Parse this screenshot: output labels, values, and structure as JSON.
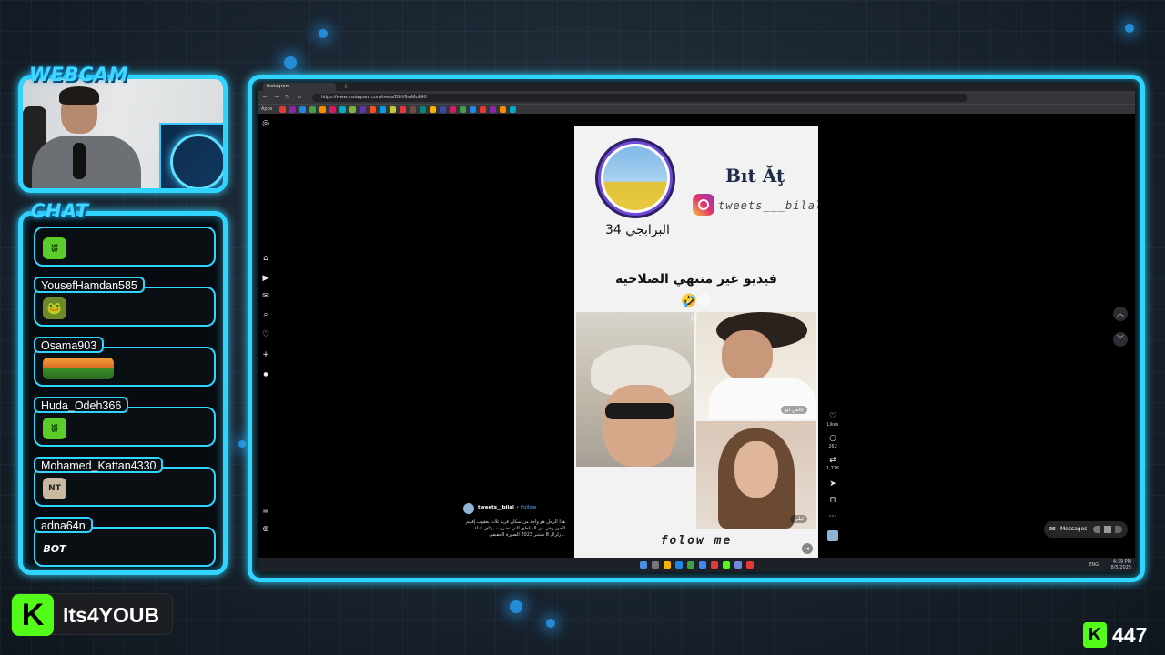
{
  "overlay": {
    "webcam_label": "WEBCAM",
    "chat_label": "CHAT",
    "streamer_name": "Its4YOUB",
    "viewer_count": "447",
    "accent_color": "#2fd4ff",
    "kick_color": "#53fc18"
  },
  "chat": {
    "messages": [
      {
        "username": "",
        "emote": "green-blob-emote"
      },
      {
        "username": "YousefHamdan585",
        "emote": "frog-emote"
      },
      {
        "username": "Osama903",
        "emote": "pixel-strip-emote"
      },
      {
        "username": "Huda_Odeh366",
        "emote": "green-blob-emote"
      },
      {
        "username": "Mohamed_Kattan4330",
        "emote": "NT"
      },
      {
        "username": "adna64n",
        "emote": "BOT"
      }
    ]
  },
  "browser": {
    "tab_title": "Instagram",
    "url": "https://www.instagram.com/reels/DbV6mMo8iK/",
    "bookmarks_label": "Apps"
  },
  "reel": {
    "brand": "Bıt Ăţ",
    "handle": "tweets___bilal",
    "profile_name_ar": "البرابجي 34",
    "caption_ar": "فيديو غير منتهي الصلاحية",
    "caption_emoji": "🤣😂",
    "video_label_top": "خاص ابو",
    "video_label_bottom": "ليلى",
    "follow_text": "folow me",
    "author": "tweets__bilal",
    "follow_link": "• Follow",
    "author_caption": "هذا الرجل هو واحد من سكان قرية ثلاث يعقوب إقليم الحوز وهي من المناطق التي تضررت برئاف أثناء زلزال 8 شتنبر 2023 الصورة الحقيقي..."
  },
  "actions": {
    "likes_label": "Likes",
    "comments_count": "262",
    "reposts_count": "1,776"
  },
  "messages_pill": {
    "label": "Messages"
  },
  "taskbar": {
    "lang": "ENG",
    "time": "4:39 PM",
    "date": "8/5/2025"
  }
}
